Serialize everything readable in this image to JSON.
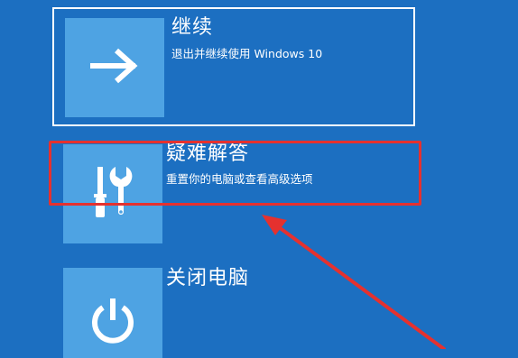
{
  "options": [
    {
      "title": "继续",
      "subtitle": "退出并继续使用 Windows 10",
      "icon": "arrow-right-icon"
    },
    {
      "title": "疑难解答",
      "subtitle": "重置你的电脑或查看高级选项",
      "icon": "tools-icon"
    },
    {
      "title": "关闭电脑",
      "icon": "power-icon"
    }
  ],
  "colors": {
    "background": "#1c6fc1",
    "tile": "#4ea3e3",
    "text": "#ffffff",
    "annotation": "#e5312f"
  }
}
